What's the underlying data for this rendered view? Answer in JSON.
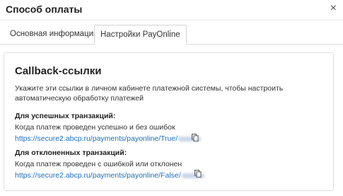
{
  "dialog": {
    "title": "Способ оплаты",
    "close_glyph": "×"
  },
  "tabs": [
    {
      "label": "Основная информация",
      "active": false
    },
    {
      "label": "Настройки PayOnline",
      "active": true
    }
  ],
  "panel": {
    "title": "Callback-ссылки",
    "description": "Укажите эти ссылки в личном кабинете платежной системы, чтобы настроить автоматическую обработку платежей",
    "success": {
      "label": "Для успешных транзакций:",
      "note": "Когда платеж проведен успешно и без ошибок",
      "url": "https://secure2.abcp.ru/payments/payonline/True/"
    },
    "fail": {
      "label": "Для отклоненных транзакций:",
      "note": "Когда платеж проведен с ошибкой или отклонен",
      "url": "https://secure2.abcp.ru/payments/payonline/False/"
    }
  },
  "icons": {
    "close": "close-icon",
    "copy": "copy-icon"
  },
  "colors": {
    "link": "#1a6fc0",
    "border": "#dedede",
    "text": "#333333"
  }
}
